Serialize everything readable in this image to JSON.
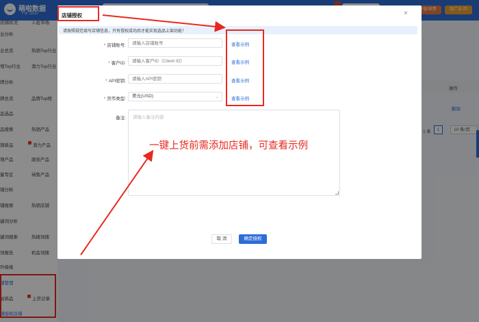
{
  "header": {
    "logo_title": "萌啦数据",
    "logo_sub": "For ozon",
    "recharge_label": "充值/续费",
    "open_shop_label": "我广告 回"
  },
  "sidebar": {
    "rows": [
      {
        "left": "店铺状况",
        "right": "入驻市场"
      },
      {
        "left": "业分析",
        "right": ""
      },
      {
        "left": "业总览",
        "right": "热销Top行业"
      },
      {
        "left": "增Top行业",
        "right": "潜力Top行业"
      },
      {
        "left": "牌分析",
        "right": ""
      },
      {
        "left": "牌总览",
        "right": "品牌Top榜"
      },
      {
        "left": "品选品",
        "right": ""
      },
      {
        "left": "品搜索",
        "right": "热销产品"
      },
      {
        "left": "销新品",
        "right": "潜力产品"
      },
      {
        "left": "增产品",
        "right": "跟卖产品"
      },
      {
        "left": "量专区",
        "right": "待售产品"
      },
      {
        "left": "铺分析",
        "right": ""
      },
      {
        "left": "铺搜索",
        "right": "热销店铺"
      },
      {
        "left": "键词分析",
        "right": ""
      },
      {
        "left": "键词搜索",
        "right": "热搜词搜"
      },
      {
        "left": "词报告",
        "right": "机会词搜"
      },
      {
        "left": "升级级",
        "right": ""
      },
      {
        "left": "铺管理",
        "right": ""
      },
      {
        "left": "加商品",
        "right": "上货记录"
      },
      {
        "left": "铺授权店铺",
        "right": ""
      }
    ]
  },
  "background": {
    "table_op_header": "操作",
    "row_delete": "删除",
    "pager_total": "1 条",
    "pager_page": "1",
    "pager_size": "10 条/页"
  },
  "modal": {
    "title": "店铺授权",
    "close_icon": "×",
    "notice": "请按照规范填写店铺信息，只有授权成功后才能实现选品上架功能！",
    "fields": {
      "shop_account": {
        "label": "店铺账号:",
        "placeholder": "请输入店铺账号"
      },
      "client_id": {
        "label": "客户ID:",
        "placeholder": "请输入客户ID（Client ID）"
      },
      "api_key": {
        "label": "API密钥:",
        "placeholder": "请输入API密钥"
      },
      "currency": {
        "label": "货币类型:",
        "value": "美元(USD)"
      },
      "remark": {
        "label": "备注:",
        "placeholder": "请输入备注内容"
      }
    },
    "example_link": "查看示例",
    "cancel_label": "取 消",
    "confirm_label": "确定授权"
  },
  "annotation": "一键上货前需添加店铺，可查看示例",
  "colors": {
    "brand_blue": "#2e6dd8",
    "highlight_red": "#e8281f"
  }
}
